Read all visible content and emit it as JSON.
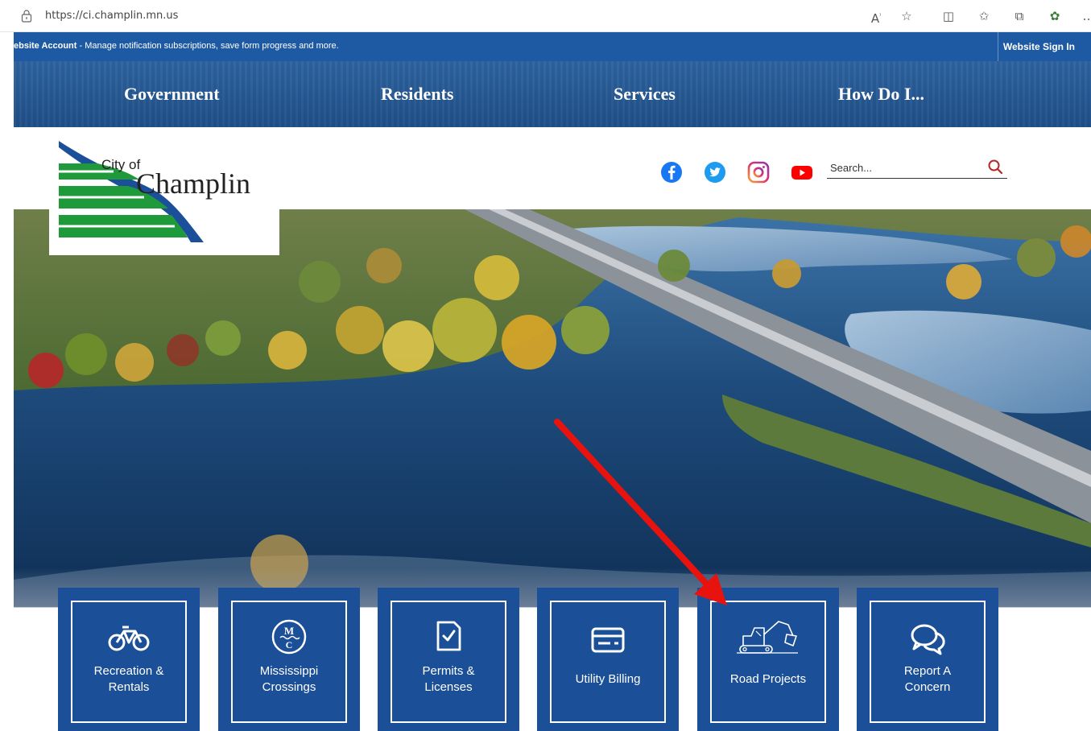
{
  "browser": {
    "url": "https://ci.champlin.mn.us",
    "icons": [
      "read-aloud-icon",
      "favorite-star-icon",
      "split-screen-icon",
      "favorites-icon",
      "collections-icon",
      "extensions-icon",
      "more-icon"
    ]
  },
  "notice": {
    "bold": "ebsite Account",
    "text": " - Manage notification subscriptions, save form progress and more.",
    "signin": "Website Sign In"
  },
  "nav": {
    "items": [
      "Government",
      "Residents",
      "Services",
      "How Do I..."
    ]
  },
  "logo": {
    "city_of": "City of",
    "name": "Champlin"
  },
  "social": [
    "facebook-icon",
    "twitter-icon",
    "instagram-icon",
    "youtube-icon"
  ],
  "search": {
    "placeholder": "Search..."
  },
  "tiles": [
    {
      "label1": "Recreation &",
      "label2": "Rentals",
      "icon": "bicycle-icon"
    },
    {
      "label1": "Mississippi",
      "label2": "Crossings",
      "icon": "mc-logo-icon"
    },
    {
      "label1": "Permits &",
      "label2": "Licenses",
      "icon": "checklist-icon"
    },
    {
      "label1": "Utility Billing",
      "label2": "",
      "icon": "bill-icon"
    },
    {
      "label1": "Road Projects",
      "label2": "",
      "icon": "excavator-icon"
    },
    {
      "label1": "Report A",
      "label2": "Concern",
      "icon": "chat-bubbles-icon"
    }
  ],
  "colors": {
    "brand_blue": "#1b4f97",
    "notice_blue": "#1d5aa3",
    "logo_green": "#1f9a3a",
    "arrow_red": "#e8130f"
  }
}
